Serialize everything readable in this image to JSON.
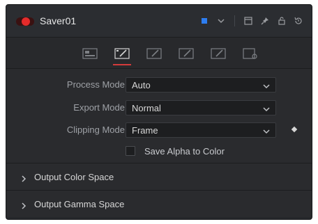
{
  "header": {
    "title": "Saver01",
    "toggle_color": "#e52b2b",
    "color_swatch": "#2d7df0",
    "icons": [
      "color-swatch-icon",
      "chevron-down-icon",
      "window-icon",
      "pin-icon",
      "lock-icon",
      "reset-icon"
    ]
  },
  "tabs": {
    "items": [
      "io-tab",
      "controls-tab",
      "tab-3",
      "tab-4",
      "tab-5",
      "settings-tab"
    ],
    "active_index": 1,
    "accent": "#d43b3b"
  },
  "controls": {
    "process_mode": {
      "label": "Process Mode",
      "value": "Auto"
    },
    "export_mode": {
      "label": "Export Mode",
      "value": "Normal"
    },
    "clipping_mode": {
      "label": "Clipping Mode",
      "value": "Frame"
    },
    "save_alpha": {
      "label": "Save Alpha to Color",
      "checked": false
    }
  },
  "sections": [
    {
      "title": "Output Color Space"
    },
    {
      "title": "Output Gamma Space"
    }
  ]
}
